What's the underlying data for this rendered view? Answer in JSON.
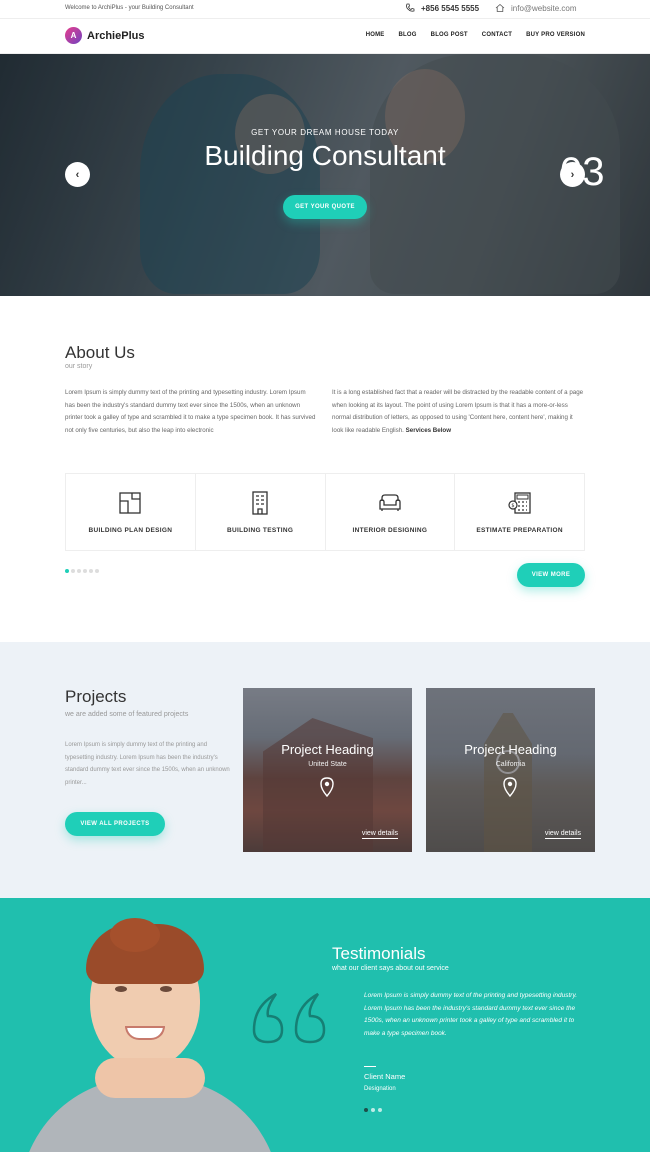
{
  "topbar": {
    "welcome": "Welcome to ArchiPlus - your Building Consultant",
    "phone": "+856 5545 5555",
    "email": "info@website.com",
    "phone_icon": "phone-icon",
    "email_icon": "home-icon"
  },
  "brand": {
    "mark": "A",
    "name": "ArchiePlus"
  },
  "nav": [
    "HOME",
    "BLOG",
    "BLOG POST",
    "CONTACT",
    "BUY PRO VERSION"
  ],
  "hero": {
    "kicker": "GET YOUR DREAM HOUSE TODAY",
    "title": "Building Consultant",
    "cta": "GET YOUR QUOTE",
    "slide_number": "03",
    "prev_icon": "chevron-left-icon",
    "next_icon": "chevron-right-icon"
  },
  "about": {
    "title": "About Us",
    "subtitle": "our story",
    "col_left": "Lorem Ipsum is simply dummy text of the printing and typesetting industry. Lorem Ipsum has been the industry's standard dummy text ever since the 1500s, when an unknown printer took a galley of type and scrambled it to make a type specimen book. It has survived not only five centuries, but also the leap into electronic",
    "col_right": "It is a long established fact that a reader will be distracted by the readable content of a page when looking at its layout. The point of using Lorem Ipsum is that it has a more-or-less normal distribution of letters, as opposed to using 'Content here, content here', making it look like readable English.",
    "col_right_link": "Services Below",
    "services": [
      {
        "label": "BUILDING PLAN DESIGN",
        "icon": "floor-plan-icon"
      },
      {
        "label": "BUILDING TESTING",
        "icon": "building-icon"
      },
      {
        "label": "INTERIOR DESIGNING",
        "icon": "sofa-icon"
      },
      {
        "label": "ESTIMATE PREPARATION",
        "icon": "calculator-icon"
      }
    ],
    "view_more": "VIEW MORE"
  },
  "projects": {
    "title": "Projects",
    "subtitle": "we are added some of featured projects",
    "description": "Lorem Ipsum is simply dummy text of the printing and typesetting industry. Lorem Ipsum has been the industry's standard dummy text ever since the 1500s, when an unknown printer...",
    "view_all": "VIEW ALL PROJECTS",
    "cards": [
      {
        "heading": "Project Heading",
        "location": "United State",
        "link": "view details"
      },
      {
        "heading": "Project Heading",
        "location": "California",
        "link": "view details"
      }
    ]
  },
  "testimonials": {
    "title": "Testimonials",
    "subtitle": "what our client says about out service",
    "text": "Lorem Ipsum is simply dummy text of the printing and typesetting industry. Lorem Ipsum has been the industry's standard dummy text ever since the 1500s, when an unknown printer took a galley of type and scrambled it to make a type specimen book.",
    "client_name": "Client Name",
    "client_role": "Designation"
  },
  "colors": {
    "accent": "#1fcfb8",
    "testimonial_bg": "#20bfae",
    "projects_bg": "#edf2f7"
  }
}
